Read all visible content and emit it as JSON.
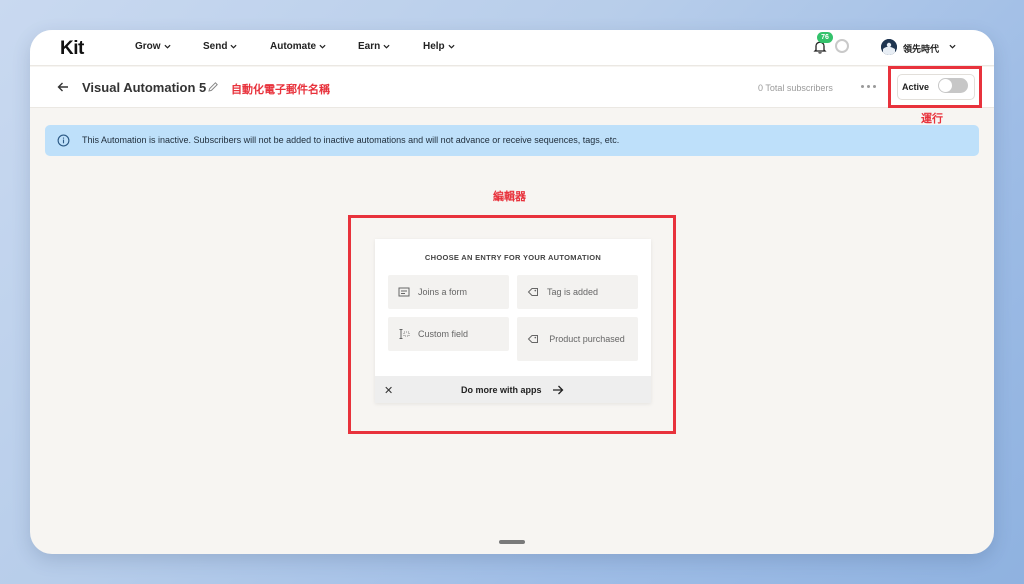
{
  "nav": {
    "logo": "Kit",
    "items": [
      {
        "label": "Grow"
      },
      {
        "label": "Send"
      },
      {
        "label": "Automate"
      },
      {
        "label": "Earn"
      },
      {
        "label": "Help"
      }
    ],
    "notification_count": "76",
    "user_name": "領先時代"
  },
  "subheader": {
    "title": "Visual Automation 5",
    "total_subscribers": "0 Total subscribers",
    "active_label": "Active",
    "active_on": false
  },
  "annotations": {
    "name": "自動化電子郵件名稱",
    "run": "運行",
    "editor": "編輯器",
    "color": "#e8323c"
  },
  "alert": {
    "text": "This Automation is inactive. Subscribers will not be added to inactive automations and will not advance or receive sequences, tags, etc."
  },
  "entry": {
    "title": "CHOOSE AN ENTRY FOR YOUR AUTOMATION",
    "options": [
      {
        "label": "Joins a form",
        "icon": "form-icon"
      },
      {
        "label": "Tag is added",
        "icon": "tag-icon"
      },
      {
        "label": "Custom field",
        "icon": "custom-field-icon"
      },
      {
        "label": "Product purchased",
        "icon": "tag-icon"
      }
    ],
    "close": "✕",
    "more_apps": "Do more with apps"
  },
  "colors": {
    "accent_green": "#34c26b",
    "alert_bg": "#bee0fa"
  }
}
